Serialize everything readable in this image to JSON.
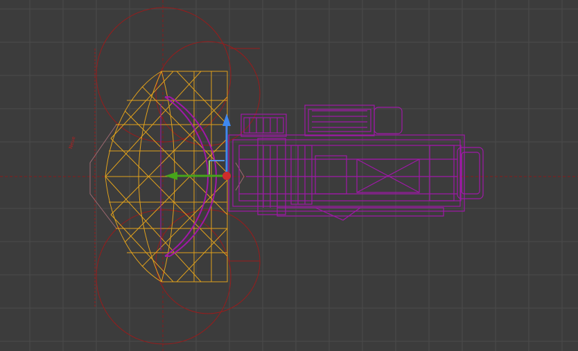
{
  "viewport": {
    "background": "#3c3c3c",
    "grid_color": "#4a4a4a",
    "axis_color": "#8a1a1a",
    "selection_color": "#e2a21c",
    "object_color": "#a018a8",
    "helper_color": "#9a1b1b"
  },
  "gizmo": {
    "x_axis_color": "#d02c2c",
    "y_axis_color": "#46a51a",
    "z_axis_color": "#3f88f0",
    "plane_yz_color": "#5a95e0",
    "plane_xy_color": "#9bc86d"
  },
  "annotations": {
    "label_text": "Neue"
  }
}
